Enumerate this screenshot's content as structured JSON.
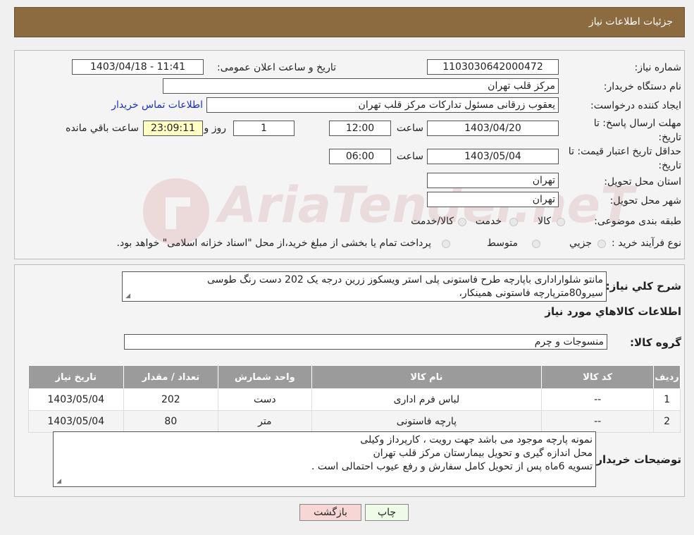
{
  "header": {
    "title": "جزئیات اطلاعات نیاز"
  },
  "watermark": {
    "text": "AriaTender.neT"
  },
  "form": {
    "need_number": {
      "label": "شماره نیاز:",
      "value": "1103030642000472"
    },
    "announce_datetime": {
      "label": "تاریخ و ساعت اعلان عمومی:",
      "value": "1403/04/18 - 11:41"
    },
    "buyer_org": {
      "label": "نام دستگاه خریدار:",
      "value": "مرکز قلب تهران"
    },
    "requester": {
      "label": "ایجاد کننده درخواست:",
      "value": "یعقوب زرقانی مسئول تداركات مركز قلب تهران",
      "contact_link": "اطلاعات تماس خریدار"
    },
    "response_deadline": {
      "label": "مهلت ارسال پاسخ: تا تاریخ:",
      "date": "1403/04/20",
      "time_label": "ساعت",
      "time": "12:00",
      "days": "1",
      "days_label": "روز و",
      "remaining": "23:09:11",
      "remaining_label": "ساعت باقي مانده"
    },
    "price_validity": {
      "label": "حداقل تاریخ اعتبار قیمت: تا تاریخ:",
      "date": "1403/05/04",
      "time_label": "ساعت",
      "time": "06:00"
    },
    "delivery_province": {
      "label": "استان محل تحویل:",
      "value": "تهران"
    },
    "delivery_city": {
      "label": "شهر محل تحویل:",
      "value": "تهران"
    },
    "category": {
      "label": "طبقه بندی موضوعی:",
      "options": [
        "کالا",
        "خدمت",
        "کالا/خدمت"
      ]
    },
    "purchase_process": {
      "label": "نوع فرآیند خرید :",
      "options": [
        "جزیي",
        "متوسط"
      ],
      "note": "پرداخت تمام یا بخشی از مبلغ خرید،از محل \"اسناد خزانه اسلامی\" خواهد بود."
    }
  },
  "summary": {
    "label": "شرح کلي نياز:",
    "line1": "مانتو شلواراداری باپارچه طرح فاستونی پلی استر ویسکوز زرین درجه یک 202 دست رنگ طوسی",
    "line2": "سیرو80مترپارچه فاستونی همینکار،"
  },
  "goods_info": {
    "title": "اطلاعات کالاهاي مورد نياز"
  },
  "goods_group": {
    "label": "گروه کالا:",
    "value": "منسوجات و چرم"
  },
  "table": {
    "headers": [
      "رديف",
      "کد کالا",
      "نام کالا",
      "واحد شمارش",
      "تعداد / مقدار",
      "تاریخ نیاز"
    ],
    "rows": [
      {
        "index": "1",
        "code": "--",
        "name": "لباس فرم اداری",
        "unit": "دست",
        "qty": "202",
        "date": "1403/05/04"
      },
      {
        "index": "2",
        "code": "--",
        "name": "پارچه فاستونی",
        "unit": "متر",
        "qty": "80",
        "date": "1403/05/04"
      }
    ]
  },
  "buyer_notes": {
    "label": "توضیحات خریدار:",
    "line1": "نمونه پارچه موجود می باشد جهت رویت ، کارپرداز وکیلی",
    "line2": "محل اندازه گیری و تحویل بیمارستان مرکز قلب تهران",
    "line3": "تسویه 6ماه پس از تحویل کامل سفارش و رفع عیوب احتمالی است ."
  },
  "buttons": {
    "print": "چاپ",
    "back": "بازگشت"
  },
  "colors": {
    "header_bg": "#8b6b3f",
    "back_button_bg": "#f7d6d6",
    "print_button_bg": "#eefbe6",
    "remaining_bg": "#ffffc4"
  }
}
